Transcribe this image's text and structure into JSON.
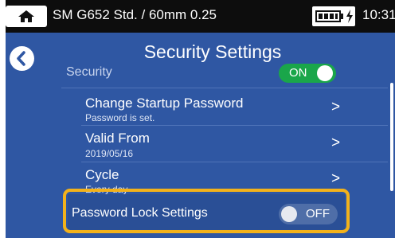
{
  "status_bar": {
    "title": "SM G652 Std. / 60mm 0.25",
    "time": "10:31",
    "battery_icon": "battery-full-icon",
    "charging_icon": "charging-bolt-icon",
    "home_icon": "home-icon"
  },
  "header": {
    "title": "Security Settings",
    "back_icon": "back-chevron-icon"
  },
  "settings": {
    "security": {
      "label": "Security",
      "toggle": "ON"
    },
    "change_password": {
      "label": "Change Startup Password",
      "sub": "Password is set.",
      "chevron": ">"
    },
    "valid_from": {
      "label": "Valid From",
      "sub": "2019/05/16",
      "chevron": ">"
    },
    "cycle": {
      "label": "Cycle",
      "sub": "Every day",
      "chevron": ">"
    },
    "password_lock": {
      "label": "Password Lock Settings",
      "toggle": "OFF"
    }
  },
  "colors": {
    "background": "#2f57a3",
    "toggle_on": "#1aa64a",
    "highlight": "#f3b21b"
  }
}
